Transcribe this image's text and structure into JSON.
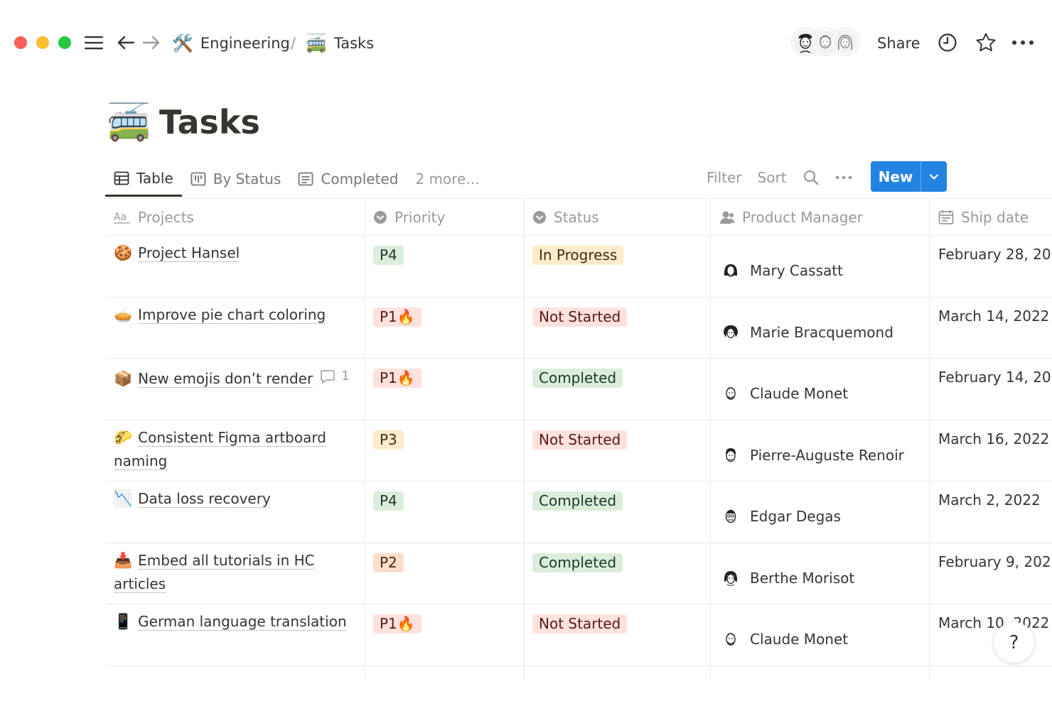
{
  "window": {
    "traffic_lights": {
      "close": "#ff5f57",
      "minimize": "#febc2e",
      "zoom": "#28c840"
    }
  },
  "breadcrumb": {
    "parent_emoji": "🛠️",
    "parent_label": "Engineering",
    "separator": "/",
    "current_emoji": "🚎",
    "current_label": "Tasks"
  },
  "header": {
    "share_label": "Share"
  },
  "page": {
    "emoji": "🚎",
    "title": "Tasks"
  },
  "views": {
    "tabs": [
      {
        "label": "Table",
        "icon": "table-icon",
        "active": true
      },
      {
        "label": "By Status",
        "icon": "board-icon",
        "active": false
      },
      {
        "label": "Completed",
        "icon": "list-icon",
        "active": false
      }
    ],
    "more_label": "2 more..."
  },
  "toolbar": {
    "filter_label": "Filter",
    "sort_label": "Sort",
    "new_label": "New",
    "accent": "#2383e2"
  },
  "table": {
    "columns": [
      {
        "label": "Projects",
        "icon": "text-property-icon"
      },
      {
        "label": "Priority",
        "icon": "select-property-icon"
      },
      {
        "label": "Status",
        "icon": "select-property-icon"
      },
      {
        "label": "Product Manager",
        "icon": "person-property-icon"
      },
      {
        "label": "Ship date",
        "icon": "calendar-icon"
      }
    ],
    "rows": [
      {
        "emoji": "🍪",
        "project": "Project Hansel",
        "comments": "",
        "priority": "P4",
        "status": "In Progress",
        "pm": "Mary Cassatt",
        "ship": "February 28, 20"
      },
      {
        "emoji": "🥧",
        "project": "Improve pie chart coloring",
        "comments": "",
        "priority": "P1🔥",
        "status": "Not Started",
        "pm": "Marie Bracquemond",
        "ship": "March 14, 2022"
      },
      {
        "emoji": "📦",
        "project": "New emojis don’t render",
        "comments": "1",
        "priority": "P1🔥",
        "status": "Completed",
        "pm": "Claude Monet",
        "ship": "February 14, 20"
      },
      {
        "emoji": "🌮",
        "project": "Consistent Figma artboard naming",
        "comments": "",
        "priority": "P3",
        "status": "Not Started",
        "pm": "Pierre-Auguste Renoir",
        "ship": "March 16, 2022"
      },
      {
        "emoji": "📉",
        "project": "Data loss recovery",
        "comments": "",
        "priority": "P4",
        "status": "Completed",
        "pm": "Edgar Degas",
        "ship": "March 2, 2022"
      },
      {
        "emoji": "📥",
        "project": "Embed all tutorials in HC articles",
        "comments": "",
        "priority": "P2",
        "status": "Completed",
        "pm": "Berthe Morisot",
        "ship": "February 9, 202"
      },
      {
        "emoji": "📱",
        "project": "German language translation",
        "comments": "",
        "priority": "P1🔥",
        "status": "Not Started",
        "pm": "Claude Monet",
        "ship": "March 10, 2022"
      }
    ]
  },
  "pill_colors": {
    "P1🔥": {
      "bg": "#ffe2dd",
      "fg": "#5d1715"
    },
    "P2": {
      "bg": "#fadec9",
      "fg": "#49290e"
    },
    "P3": {
      "bg": "#fdecc8",
      "fg": "#402c1b"
    },
    "P4": {
      "bg": "#dbeddb",
      "fg": "#1c3829"
    },
    "In Progress": {
      "bg": "#fdecc8",
      "fg": "#402c1b"
    },
    "Not Started": {
      "bg": "#ffe2dd",
      "fg": "#5d1715"
    },
    "Completed": {
      "bg": "#dbeddb",
      "fg": "#1c3829"
    }
  },
  "help_label": "?"
}
